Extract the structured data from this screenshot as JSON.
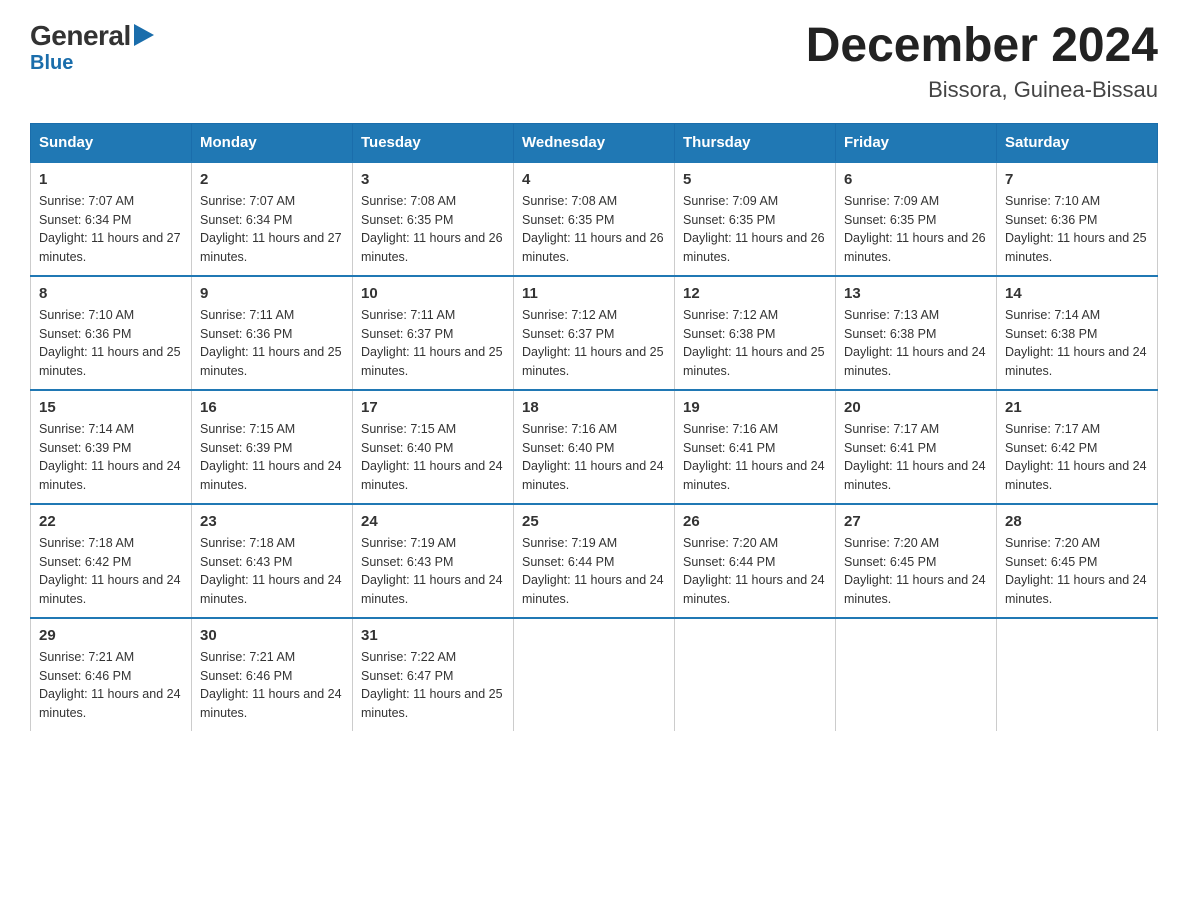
{
  "header": {
    "logo_line1": "General",
    "logo_line2": "Blue",
    "month_title": "December 2024",
    "location": "Bissora, Guinea-Bissau"
  },
  "weekdays": [
    "Sunday",
    "Monday",
    "Tuesday",
    "Wednesday",
    "Thursday",
    "Friday",
    "Saturday"
  ],
  "weeks": [
    [
      {
        "day": "1",
        "sunrise": "7:07 AM",
        "sunset": "6:34 PM",
        "daylight": "11 hours and 27 minutes."
      },
      {
        "day": "2",
        "sunrise": "7:07 AM",
        "sunset": "6:34 PM",
        "daylight": "11 hours and 27 minutes."
      },
      {
        "day": "3",
        "sunrise": "7:08 AM",
        "sunset": "6:35 PM",
        "daylight": "11 hours and 26 minutes."
      },
      {
        "day": "4",
        "sunrise": "7:08 AM",
        "sunset": "6:35 PM",
        "daylight": "11 hours and 26 minutes."
      },
      {
        "day": "5",
        "sunrise": "7:09 AM",
        "sunset": "6:35 PM",
        "daylight": "11 hours and 26 minutes."
      },
      {
        "day": "6",
        "sunrise": "7:09 AM",
        "sunset": "6:35 PM",
        "daylight": "11 hours and 26 minutes."
      },
      {
        "day": "7",
        "sunrise": "7:10 AM",
        "sunset": "6:36 PM",
        "daylight": "11 hours and 25 minutes."
      }
    ],
    [
      {
        "day": "8",
        "sunrise": "7:10 AM",
        "sunset": "6:36 PM",
        "daylight": "11 hours and 25 minutes."
      },
      {
        "day": "9",
        "sunrise": "7:11 AM",
        "sunset": "6:36 PM",
        "daylight": "11 hours and 25 minutes."
      },
      {
        "day": "10",
        "sunrise": "7:11 AM",
        "sunset": "6:37 PM",
        "daylight": "11 hours and 25 minutes."
      },
      {
        "day": "11",
        "sunrise": "7:12 AM",
        "sunset": "6:37 PM",
        "daylight": "11 hours and 25 minutes."
      },
      {
        "day": "12",
        "sunrise": "7:12 AM",
        "sunset": "6:38 PM",
        "daylight": "11 hours and 25 minutes."
      },
      {
        "day": "13",
        "sunrise": "7:13 AM",
        "sunset": "6:38 PM",
        "daylight": "11 hours and 24 minutes."
      },
      {
        "day": "14",
        "sunrise": "7:14 AM",
        "sunset": "6:38 PM",
        "daylight": "11 hours and 24 minutes."
      }
    ],
    [
      {
        "day": "15",
        "sunrise": "7:14 AM",
        "sunset": "6:39 PM",
        "daylight": "11 hours and 24 minutes."
      },
      {
        "day": "16",
        "sunrise": "7:15 AM",
        "sunset": "6:39 PM",
        "daylight": "11 hours and 24 minutes."
      },
      {
        "day": "17",
        "sunrise": "7:15 AM",
        "sunset": "6:40 PM",
        "daylight": "11 hours and 24 minutes."
      },
      {
        "day": "18",
        "sunrise": "7:16 AM",
        "sunset": "6:40 PM",
        "daylight": "11 hours and 24 minutes."
      },
      {
        "day": "19",
        "sunrise": "7:16 AM",
        "sunset": "6:41 PM",
        "daylight": "11 hours and 24 minutes."
      },
      {
        "day": "20",
        "sunrise": "7:17 AM",
        "sunset": "6:41 PM",
        "daylight": "11 hours and 24 minutes."
      },
      {
        "day": "21",
        "sunrise": "7:17 AM",
        "sunset": "6:42 PM",
        "daylight": "11 hours and 24 minutes."
      }
    ],
    [
      {
        "day": "22",
        "sunrise": "7:18 AM",
        "sunset": "6:42 PM",
        "daylight": "11 hours and 24 minutes."
      },
      {
        "day": "23",
        "sunrise": "7:18 AM",
        "sunset": "6:43 PM",
        "daylight": "11 hours and 24 minutes."
      },
      {
        "day": "24",
        "sunrise": "7:19 AM",
        "sunset": "6:43 PM",
        "daylight": "11 hours and 24 minutes."
      },
      {
        "day": "25",
        "sunrise": "7:19 AM",
        "sunset": "6:44 PM",
        "daylight": "11 hours and 24 minutes."
      },
      {
        "day": "26",
        "sunrise": "7:20 AM",
        "sunset": "6:44 PM",
        "daylight": "11 hours and 24 minutes."
      },
      {
        "day": "27",
        "sunrise": "7:20 AM",
        "sunset": "6:45 PM",
        "daylight": "11 hours and 24 minutes."
      },
      {
        "day": "28",
        "sunrise": "7:20 AM",
        "sunset": "6:45 PM",
        "daylight": "11 hours and 24 minutes."
      }
    ],
    [
      {
        "day": "29",
        "sunrise": "7:21 AM",
        "sunset": "6:46 PM",
        "daylight": "11 hours and 24 minutes."
      },
      {
        "day": "30",
        "sunrise": "7:21 AM",
        "sunset": "6:46 PM",
        "daylight": "11 hours and 24 minutes."
      },
      {
        "day": "31",
        "sunrise": "7:22 AM",
        "sunset": "6:47 PM",
        "daylight": "11 hours and 25 minutes."
      },
      null,
      null,
      null,
      null
    ]
  ]
}
